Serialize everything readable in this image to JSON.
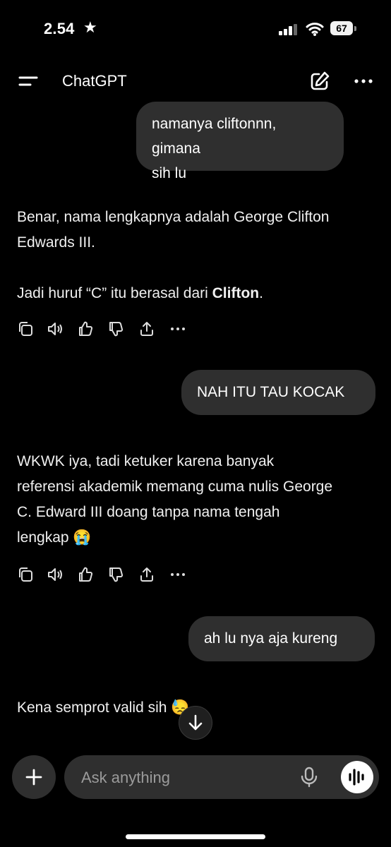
{
  "status_bar": {
    "time": "2.54",
    "battery": "67"
  },
  "header": {
    "title": "ChatGPT"
  },
  "messages": [
    {
      "role": "user",
      "lines": [
        "namanya cliftonnn, gimana",
        "sih lu"
      ]
    },
    {
      "role": "assistant",
      "lines": [
        "Benar, nama lengkapnya adalah George Clifton",
        "Edwards III."
      ],
      "line2_pre": "Jadi huruf “C” itu berasal dari ",
      "line2_bold": "Clifton",
      "line2_post": "."
    },
    {
      "role": "user",
      "text": "NAH ITU TAU KOCAK"
    },
    {
      "role": "assistant",
      "lines": [
        "WKWK iya, tadi ketuker karena banyak",
        "referensi akademik memang cuma nulis George",
        "C. Edward III doang tanpa nama tengah",
        "lengkap 😭"
      ]
    },
    {
      "role": "user",
      "text": "ah lu nya aja kureng"
    },
    {
      "role": "assistant",
      "text": "Kena semprot valid sih 😓"
    }
  ],
  "composer": {
    "placeholder": "Ask anything"
  },
  "icons": {
    "menu": "menu-icon",
    "edit": "new-chat-icon",
    "more": "more-icon",
    "copy": "copy-icon",
    "speaker": "read-aloud-icon",
    "like": "thumbs-up-icon",
    "dislike": "thumbs-down-icon",
    "share": "share-icon",
    "ellipsis": "more-actions-icon",
    "plus": "plus-icon",
    "mic": "mic-icon",
    "voice": "voice-mode-icon",
    "down": "arrow-down-icon"
  },
  "colors": {
    "background": "#000000",
    "bubble": "#2f2f2f",
    "text": "#ffffff",
    "placeholder": "#9b9b9b"
  }
}
